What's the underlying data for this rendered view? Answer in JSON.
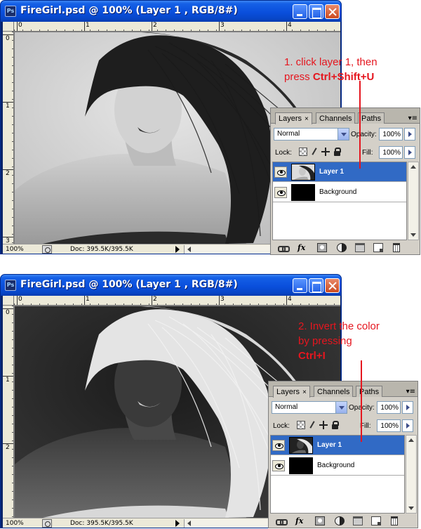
{
  "windows": [
    {
      "title": "FireGirl.psd @ 100% (Layer 1 , RGB/8#)",
      "app_icon": "Ps",
      "ruler_h": [
        "0",
        "1",
        "2",
        "3",
        "4"
      ],
      "ruler_v": [
        "0",
        "1",
        "2",
        "3"
      ],
      "zoom": "100%",
      "doc_size": "Doc: 395.5K/395.5K",
      "photo_mode": "original-grayscale"
    },
    {
      "title": "FireGirl.psd @ 100% (Layer 1 , RGB/8#)",
      "app_icon": "Ps",
      "ruler_h": [
        "0",
        "1",
        "2",
        "3",
        "4"
      ],
      "ruler_v": [
        "0",
        "1",
        "2"
      ],
      "zoom": "100%",
      "doc_size": "Doc: 395.5K/395.5K",
      "photo_mode": "inverted"
    }
  ],
  "layers_panels": [
    {
      "tabs": [
        "Layers",
        "Channels",
        "Paths"
      ],
      "tab_close": "×",
      "menu_icon": "▾≡",
      "blend_mode": "Normal",
      "opacity_label": "Opacity:",
      "opacity_value": "100%",
      "lock_label": "Lock:",
      "fill_label": "Fill:",
      "fill_value": "100%",
      "layers": [
        {
          "name": "Layer 1",
          "selected": true,
          "thumb": "photo"
        },
        {
          "name": "Background",
          "selected": false,
          "thumb": "black"
        }
      ],
      "footer_fx": "fx"
    },
    {
      "tabs": [
        "Layers",
        "Channels",
        "Paths"
      ],
      "tab_close": "×",
      "menu_icon": "▾≡",
      "blend_mode": "Normal",
      "opacity_label": "Opacity:",
      "opacity_value": "100%",
      "lock_label": "Lock:",
      "fill_label": "Fill:",
      "fill_value": "100%",
      "layers": [
        {
          "name": "Layer 1",
          "selected": true,
          "thumb": "photo-inverted"
        },
        {
          "name": "Background",
          "selected": false,
          "thumb": "black"
        }
      ],
      "footer_fx": "fx"
    }
  ],
  "annotations": [
    {
      "line1": "1. click layer 1, then",
      "line2_prefix": "press ",
      "line2_bold": "Ctrl+Shift+U"
    },
    {
      "line1": "2. Invert the color",
      "line2": "by pressing",
      "line3_bold": "Ctrl+I"
    }
  ],
  "colors": {
    "titlebar_blue": "#0a4fdc",
    "selected_layer": "#316ac5",
    "annotation_red": "#e5161f"
  }
}
